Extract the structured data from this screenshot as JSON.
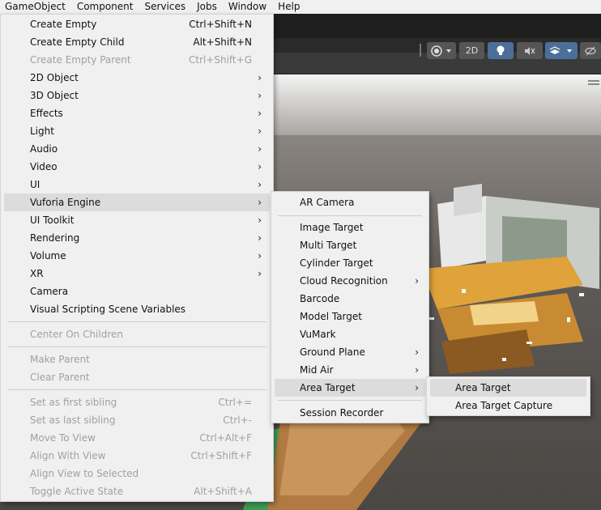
{
  "menubar": {
    "items": [
      "GameObject",
      "Component",
      "Services",
      "Jobs",
      "Window",
      "Help"
    ]
  },
  "toolbar": {
    "mode_2d": "2D"
  },
  "gameobject_menu": {
    "items": [
      {
        "label": "Create Empty",
        "shortcut": "Ctrl+Shift+N"
      },
      {
        "label": "Create Empty Child",
        "shortcut": "Alt+Shift+N"
      },
      {
        "label": "Create Empty Parent",
        "shortcut": "Ctrl+Shift+G"
      },
      {
        "label": "2D Object"
      },
      {
        "label": "3D Object"
      },
      {
        "label": "Effects"
      },
      {
        "label": "Light"
      },
      {
        "label": "Audio"
      },
      {
        "label": "Video"
      },
      {
        "label": "UI"
      },
      {
        "label": "Vuforia Engine"
      },
      {
        "label": "UI Toolkit"
      },
      {
        "label": "Rendering"
      },
      {
        "label": "Volume"
      },
      {
        "label": "XR"
      },
      {
        "label": "Camera"
      },
      {
        "label": "Visual Scripting Scene Variables"
      },
      {
        "label": "Center On Children"
      },
      {
        "label": "Make Parent"
      },
      {
        "label": "Clear Parent"
      },
      {
        "label": "Set as first sibling",
        "shortcut": "Ctrl+="
      },
      {
        "label": "Set as last sibling",
        "shortcut": "Ctrl+-"
      },
      {
        "label": "Move To View",
        "shortcut": "Ctrl+Alt+F"
      },
      {
        "label": "Align With View",
        "shortcut": "Ctrl+Shift+F"
      },
      {
        "label": "Align View to Selected"
      },
      {
        "label": "Toggle Active State",
        "shortcut": "Alt+Shift+A"
      }
    ]
  },
  "vuforia_menu": {
    "items": [
      {
        "label": "AR Camera"
      },
      {
        "label": "Image Target"
      },
      {
        "label": "Multi Target"
      },
      {
        "label": "Cylinder Target"
      },
      {
        "label": "Cloud Recognition"
      },
      {
        "label": "Barcode"
      },
      {
        "label": "Model Target"
      },
      {
        "label": "VuMark"
      },
      {
        "label": "Ground Plane"
      },
      {
        "label": "Mid Air"
      },
      {
        "label": "Area Target"
      },
      {
        "label": "Session Recorder"
      }
    ]
  },
  "area_target_menu": {
    "items": [
      {
        "label": "Area Target"
      },
      {
        "label": "Area Target Capture"
      }
    ]
  },
  "arrow_glyph": "›"
}
